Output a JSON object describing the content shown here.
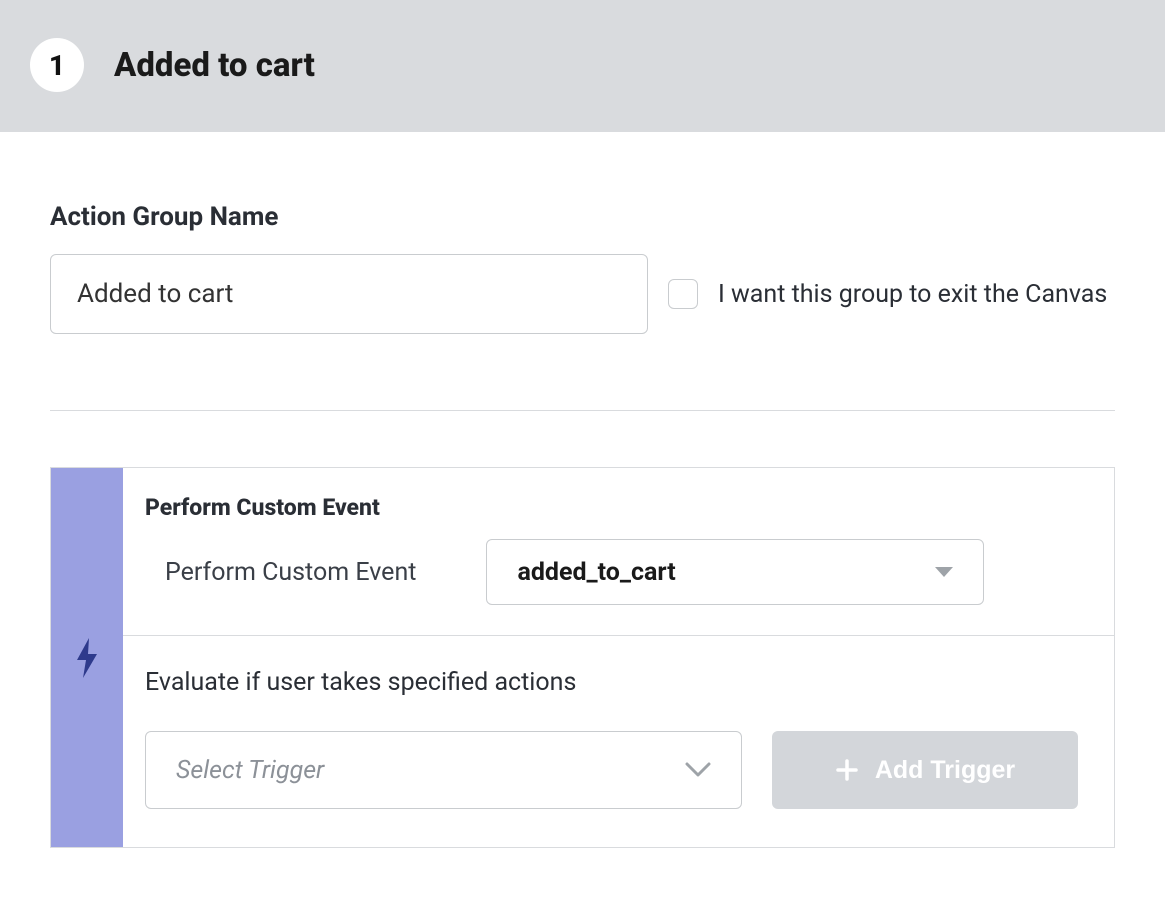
{
  "header": {
    "step_number": "1",
    "title": "Added to cart"
  },
  "form": {
    "group_name_label": "Action Group Name",
    "group_name_value": "Added to cart",
    "exit_canvas_label": "I want this group to exit the Canvas"
  },
  "event": {
    "section_title": "Perform Custom Event",
    "row_label": "Perform Custom Event",
    "selected_event": "added_to_cart",
    "evaluate_label": "Evaluate if user takes specified actions",
    "trigger_placeholder": "Select Trigger",
    "add_trigger_label": "Add Trigger"
  }
}
